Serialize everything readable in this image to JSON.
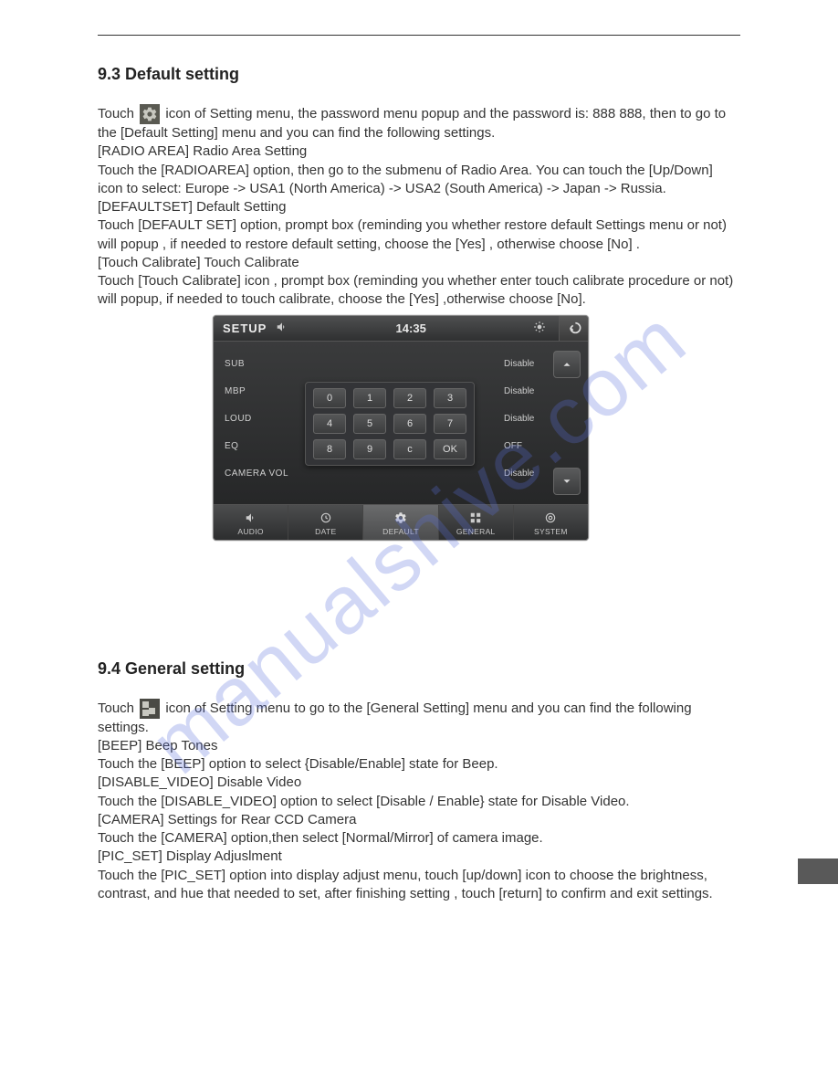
{
  "watermark": "manualshive.com",
  "section93": {
    "heading": "9.3 Default setting",
    "p1a": "Touch ",
    "p1b": " icon of Setting menu, the password menu popup and the password is: 888 888, then to go to the [Default Setting] menu and you can find the following settings.",
    "p2": "[RADIO AREA] Radio Area Setting",
    "p3": "Touch the [RADIOAREA] option, then go to the submenu of Radio Area. You can touch the [Up/Down] icon to select: Europe -> USA1 (North America) -> USA2 (South America) -> Japan -> Russia.",
    "p4": "[DEFAULTSET] Default Setting",
    "p5": "Touch [DEFAULT SET] option, prompt box (reminding you whether restore default Settings menu or not) will popup , if needed to restore default setting, choose the [Yes] , otherwise choose [No] .",
    "p6": "[Touch Calibrate] Touch Calibrate",
    "p7": "Touch [Touch Calibrate] icon , prompt box (reminding you whether enter touch calibrate procedure or not) will popup, if needed to touch calibrate, choose the [Yes] ,otherwise choose [No]."
  },
  "device": {
    "title": "SETUP",
    "time": "14:35",
    "rows": [
      {
        "label": "SUB",
        "value": "Disable"
      },
      {
        "label": "MBP",
        "value": "Disable"
      },
      {
        "label": "LOUD",
        "value": "Disable"
      },
      {
        "label": "EQ",
        "value": "OFF"
      },
      {
        "label": "CAMERA VOL",
        "value": "Disable"
      }
    ],
    "keypad": [
      "0",
      "1",
      "2",
      "3",
      "4",
      "5",
      "6",
      "7",
      "8",
      "9",
      "c",
      "OK"
    ],
    "tabs": [
      "AUDIO",
      "DATE",
      "DEFAULT",
      "GENERAL",
      "SYSTEM"
    ],
    "activeTab": "DEFAULT"
  },
  "section94": {
    "heading": "9.4 General setting",
    "p1a": "Touch ",
    "p1b": " icon of Setting menu to go to the [General Setting] menu and you can find the following settings.",
    "p2": "[BEEP] Beep Tones",
    "p3": "Touch the [BEEP] option to select {Disable/Enable] state for Beep.",
    "p4": "[DISABLE_VIDEO] Disable Video",
    "p5": "Touch the [DISABLE_VIDEO] option to select [Disable / Enable} state for Disable Video.",
    "p6": "[CAMERA] Settings for Rear CCD Camera",
    "p7": "Touch the [CAMERA] option,then select [Normal/Mirror] of camera image.",
    "p8": "[PIC_SET] Display Adjuslment",
    "p9": "Touch the [PIC_SET] option into display adjust menu, touch [up/down] icon to choose the brightness, contrast, and hue that needed to set, after finishing setting , touch [return] to confirm and exit settings."
  }
}
